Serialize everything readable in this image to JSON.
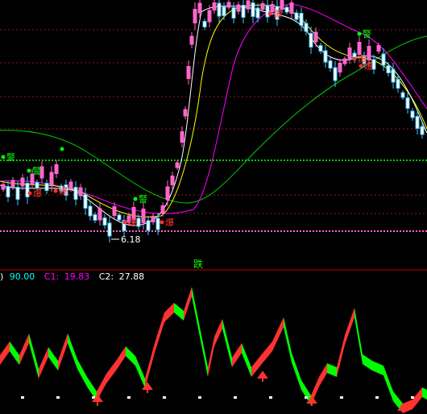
{
  "main_chart": {
    "low_label": "6.18",
    "warning_labels": [
      "警",
      "警",
      "警",
      "警"
    ],
    "burst_labels": [
      "爆",
      "爆",
      "爆",
      "爆",
      "爆",
      "爆",
      "爆"
    ]
  },
  "divider": {
    "label": "跌",
    "label_color": "#00ff00"
  },
  "indicator_header": {
    "prefix": ")",
    "value": "90.00",
    "c1_label": "C1:",
    "c1_value": "19.83",
    "c2_label": "C2:",
    "c2_value": "27.88",
    "value_color": "#00ffff",
    "c1_color": "#ff00ff",
    "c2_color": "#ffffff"
  },
  "colors": {
    "up": "#ff3232",
    "down": "#00ff00",
    "bull_candle": "#ff66cc",
    "bear_candle": "#40c8ff",
    "ma_fast": "#ffffff",
    "ma_mid": "#ffff00",
    "ma_slow": "#ff00ff",
    "ma_long": "#00cc00",
    "grid_dash": "#8b1a1a",
    "support_green": "#00cc00",
    "support_pink": "#ff66cc",
    "separator": "#c00000"
  },
  "icons": {
    "buy_arrow": "up-arrow-icon",
    "dot_marker": "dot-icon"
  }
}
